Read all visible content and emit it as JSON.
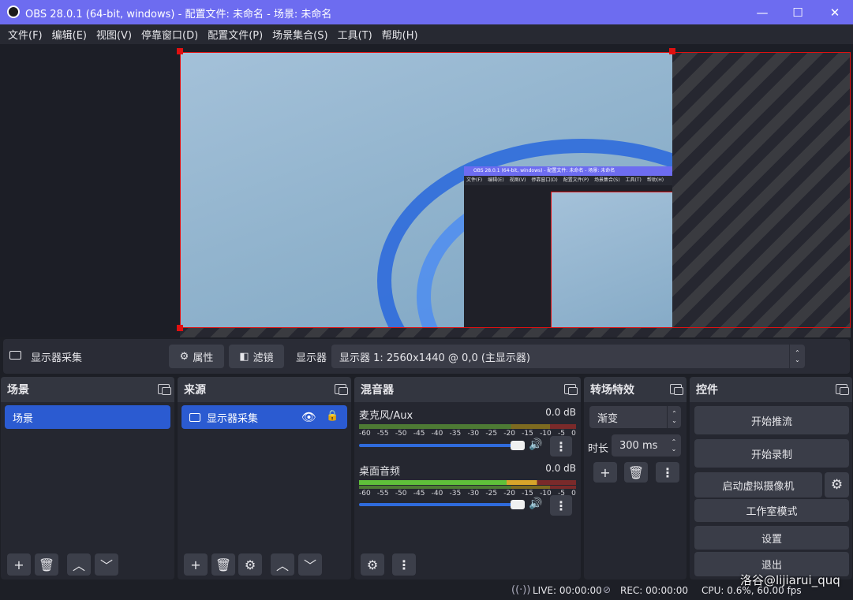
{
  "window": {
    "title": "OBS 28.0.1 (64-bit, windows) - 配置文件: 未命名 - 场景: 未命名",
    "minimize": "—",
    "maximize": "☐",
    "close": "✕"
  },
  "menu": [
    "文件(F)",
    "编辑(E)",
    "视图(V)",
    "停靠窗口(D)",
    "配置文件(P)",
    "场景集合(S)",
    "工具(T)",
    "帮助(H)"
  ],
  "nested_preview": {
    "title": "OBS 28.0.1 (64-bit, windows) - 配置文件: 未命名 - 场景: 未命名",
    "menu": [
      "文件(F)",
      "编辑(E)",
      "视图(V)",
      "停靠窗口(D)",
      "配置文件(P)",
      "场景集合(S)",
      "工具(T)",
      "帮助(H)"
    ]
  },
  "source_toolbar": {
    "source_name": "显示器采集",
    "properties_label": "属性",
    "filters_label": "滤镜",
    "display_label": "显示器",
    "display_value": "显示器 1: 2560x1440 @ 0,0 (主显示器)"
  },
  "scenes": {
    "title": "场景",
    "items": [
      "场景"
    ]
  },
  "sources": {
    "title": "来源",
    "items": [
      "显示器采集"
    ]
  },
  "mixer": {
    "title": "混音器",
    "scale": [
      "-60",
      "-55",
      "-50",
      "-45",
      "-40",
      "-35",
      "-30",
      "-25",
      "-20",
      "-15",
      "-10",
      "-5",
      "0"
    ],
    "channels": [
      {
        "name": "麦克风/Aux",
        "level": "0.0 dB",
        "volume": 1.0
      },
      {
        "name": "桌面音频",
        "level": "0.0 dB",
        "volume": 1.0
      }
    ]
  },
  "transitions": {
    "title": "转场特效",
    "type": "渐变",
    "duration_label": "时长",
    "duration_value": "300 ms"
  },
  "controls": {
    "title": "控件",
    "start_stream": "开始推流",
    "start_record": "开始录制",
    "virtual_cam": "启动虚拟摄像机",
    "studio_mode": "工作室模式",
    "settings": "设置",
    "exit": "退出"
  },
  "status": {
    "live": "LIVE: 00:00:00",
    "rec": "REC: 00:00:00",
    "cpu": "CPU: 0.6%, 60.00 fps"
  },
  "watermark": "洛谷@lijiarui_quq",
  "colors": {
    "titlebar": "#6d6cf0",
    "accent": "#2b5bd1",
    "selection_outline": "#e01010"
  }
}
